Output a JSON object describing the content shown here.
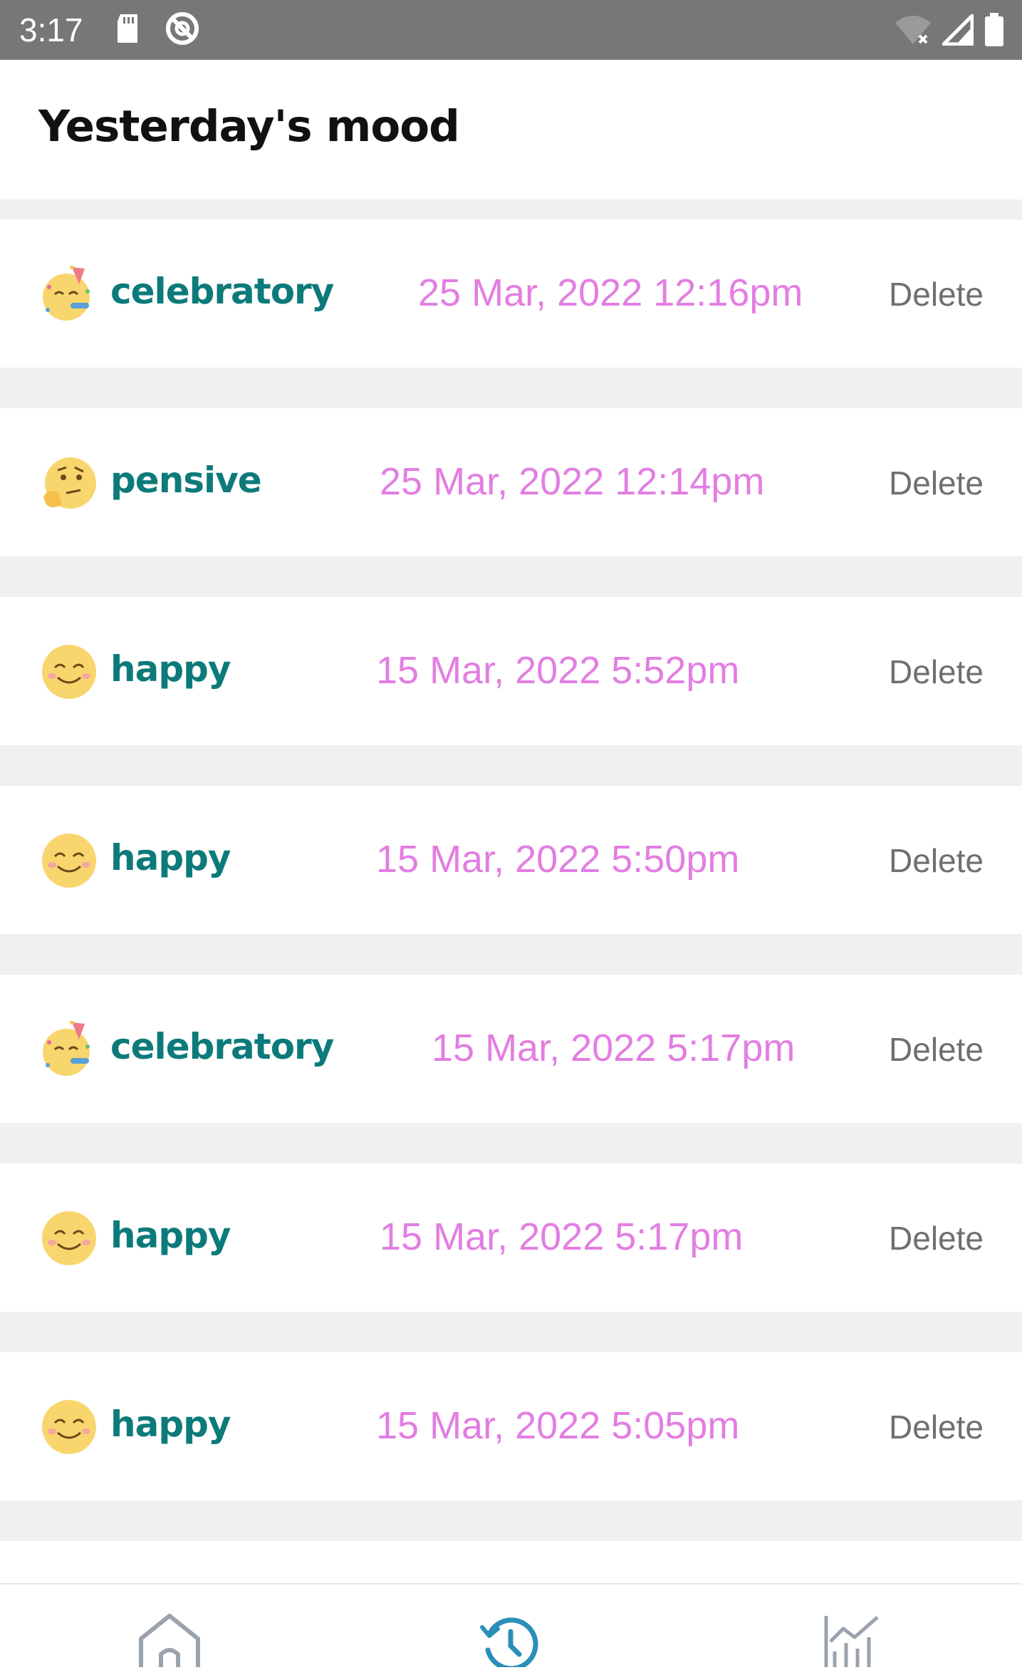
{
  "status_bar": {
    "time": "3:17",
    "icons": [
      "sd-card-icon",
      "no-sync-icon",
      "wifi-off-icon",
      "signal-icon",
      "battery-icon"
    ]
  },
  "header": {
    "title": "Yesterday's mood"
  },
  "moods": [
    {
      "emoji": "celebratory-emoji-icon",
      "label": "celebratory",
      "datetime": "25 Mar, 2022 12:16pm",
      "delete_label": "Delete"
    },
    {
      "emoji": "pensive-emoji-icon",
      "label": "pensive",
      "datetime": "25 Mar, 2022 12:14pm",
      "delete_label": "Delete"
    },
    {
      "emoji": "happy-emoji-icon",
      "label": "happy",
      "datetime": "15 Mar, 2022 5:52pm",
      "delete_label": "Delete"
    },
    {
      "emoji": "happy-emoji-icon",
      "label": "happy",
      "datetime": "15 Mar, 2022 5:50pm",
      "delete_label": "Delete"
    },
    {
      "emoji": "celebratory-emoji-icon",
      "label": "celebratory",
      "datetime": "15 Mar, 2022 5:17pm",
      "delete_label": "Delete"
    },
    {
      "emoji": "happy-emoji-icon",
      "label": "happy",
      "datetime": "15 Mar, 2022 5:17pm",
      "delete_label": "Delete"
    },
    {
      "emoji": "happy-emoji-icon",
      "label": "happy",
      "datetime": "15 Mar, 2022 5:05pm",
      "delete_label": "Delete"
    }
  ],
  "bottom_nav": {
    "items": [
      {
        "icon": "home-icon",
        "active": false
      },
      {
        "icon": "history-icon",
        "active": true
      },
      {
        "icon": "analytics-icon",
        "active": false
      }
    ]
  },
  "colors": {
    "mood_label": "#0d7a7a",
    "datetime": "#e27ee2",
    "delete": "#6f6f6f",
    "nav_active": "#2a8fb8",
    "nav_inactive": "#9aa3ad",
    "status_bar": "#777777"
  }
}
